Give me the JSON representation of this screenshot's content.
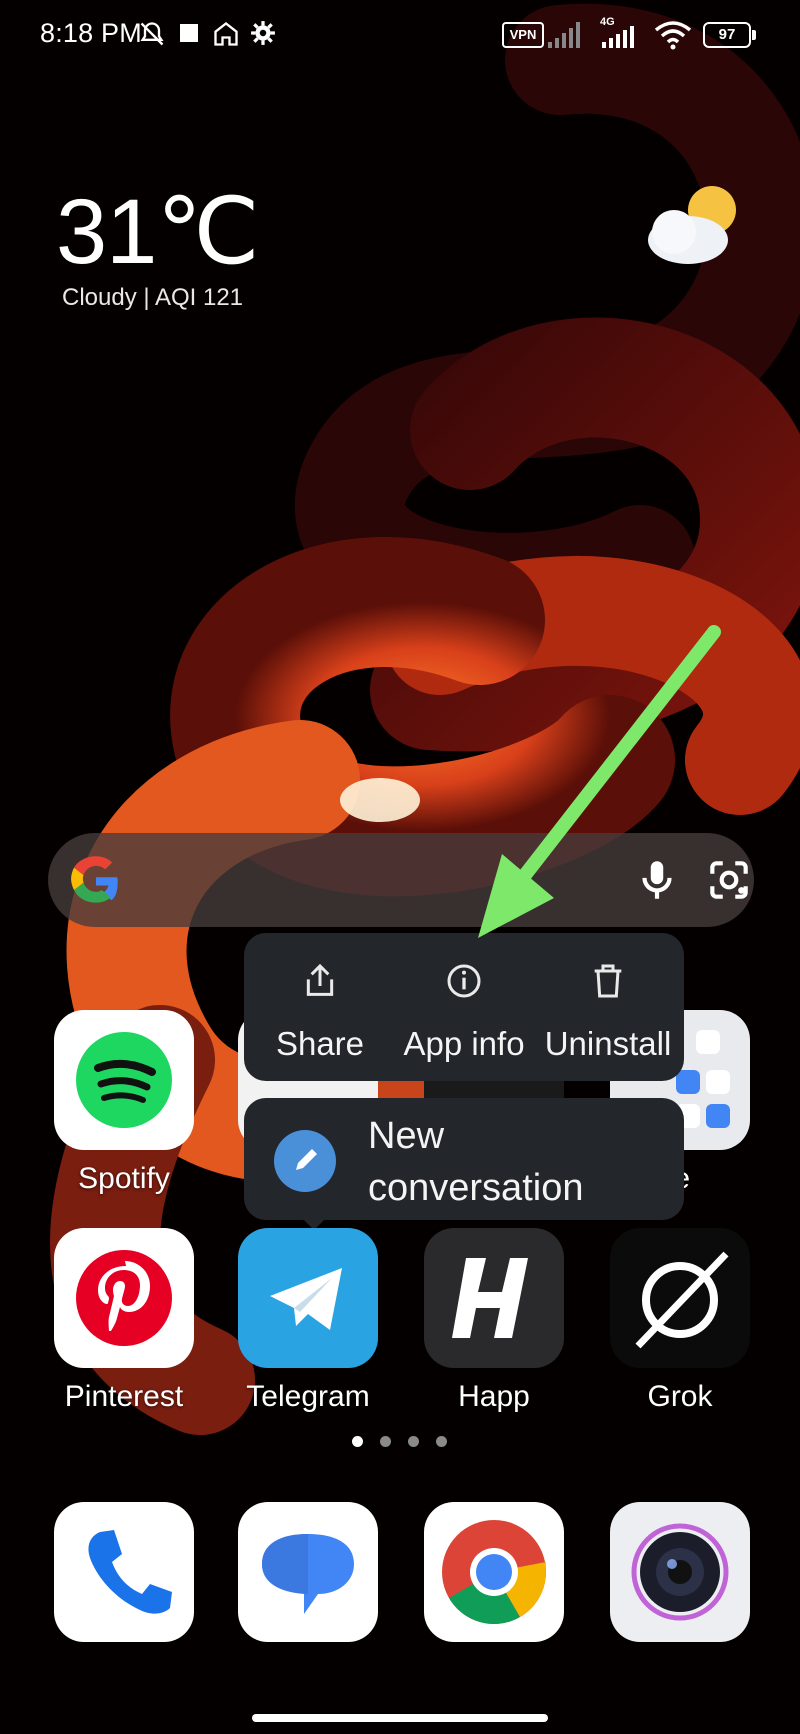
{
  "status_bar": {
    "time": "8:18 PM",
    "vpn": "VPN",
    "network": "4G",
    "battery": "97"
  },
  "weather": {
    "temperature": "31℃",
    "summary": "Cloudy | AQI 121",
    "icon": "cloud-sun-icon"
  },
  "search": {
    "logo": "google-g-icon",
    "mic": "mic-icon",
    "lens": "lens-icon"
  },
  "context_menu": {
    "share": "Share",
    "app_info": "App info",
    "uninstall": "Uninstall",
    "shortcut": "New conversation"
  },
  "apps": {
    "row1": [
      "Spotify",
      "",
      "",
      "Google"
    ],
    "row1_visible_last": "gle",
    "row2": [
      "Pinterest",
      "Telegram",
      "Happ",
      "Grok"
    ],
    "dock": [
      "Phone",
      "Messages",
      "Chrome",
      "Camera"
    ]
  },
  "page_indicator": {
    "count": 4,
    "active": 0
  },
  "colors": {
    "popup_bg": "#23262b",
    "arrow": "#7ee86a",
    "telegram": "#2aa3e3",
    "spotify": "#1ed760",
    "pinterest": "#e60023"
  }
}
